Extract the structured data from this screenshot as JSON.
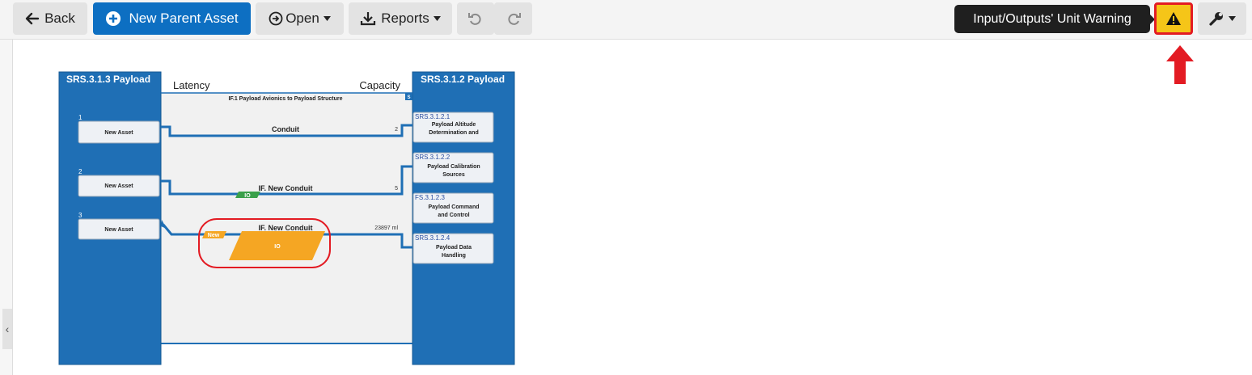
{
  "toolbar": {
    "back_label": "Back",
    "new_parent_label": "New Parent Asset",
    "open_label": "Open",
    "reports_label": "Reports",
    "warning_tooltip": "Input/Outputs' Unit Warning"
  },
  "colors": {
    "primary": "#0d6fc2",
    "system_blue": "#1f6fb5",
    "warning_yellow": "#f5c518",
    "highlight_red": "#e31b23",
    "io_orange": "#f5a623",
    "io_green": "#3aa04a"
  },
  "diagram": {
    "left_system": "SRS.3.1.3 Payload",
    "right_system": "SRS.3.1.2 Payload",
    "latency_label": "Latency",
    "capacity_label": "Capacity",
    "interface_title": "IF.1 Payload Avionics to Payload Structure",
    "s_badge": "S",
    "left_assets": [
      {
        "num": "1",
        "label": "New Asset"
      },
      {
        "num": "2",
        "label": "New Asset"
      },
      {
        "num": "3",
        "label": "New Asset"
      }
    ],
    "right_assets": [
      {
        "id": "SRS.3.1.2.1",
        "line1": "Payload Altitude",
        "line2": "Determination and"
      },
      {
        "id": "SRS.3.1.2.2",
        "line1": "Payload Calibration",
        "line2": "Sources"
      },
      {
        "id": "FS.3.1.2.3",
        "line1": "Payload Command",
        "line2": "and Control"
      },
      {
        "id": "SRS.3.1.2.4",
        "line1": "Payload Data",
        "line2": "Handling"
      }
    ],
    "conduits": [
      {
        "label": "Conduit",
        "capacity": "2"
      },
      {
        "label": "IF. New Conduit",
        "capacity": "5",
        "io_tag": "IO"
      },
      {
        "label": "IF. New Conduit",
        "capacity": "23897 ml",
        "new_tag": "New",
        "io_label": "IO"
      }
    ]
  }
}
